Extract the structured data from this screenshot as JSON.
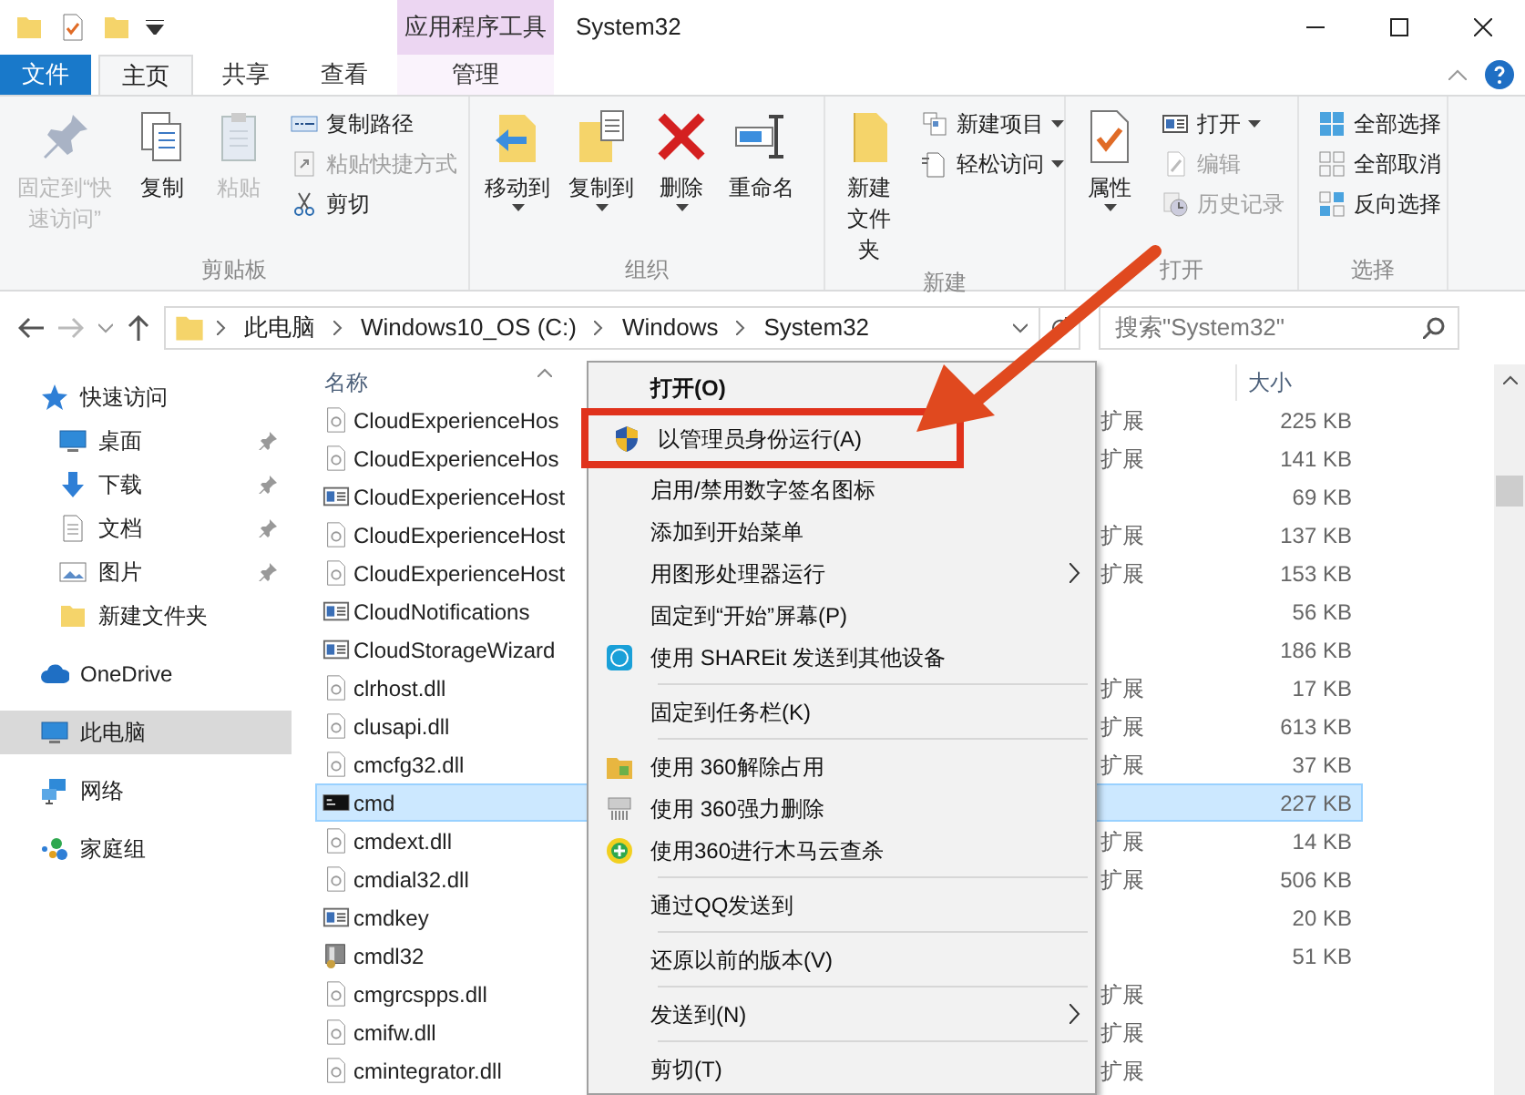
{
  "title_bar": {
    "context_tab_group": "应用程序工具",
    "title": "System32"
  },
  "tabs": [
    {
      "label": "文件",
      "kind": "file",
      "selected": false
    },
    {
      "label": "主页",
      "kind": "normal",
      "selected": true
    },
    {
      "label": "共享",
      "kind": "normal",
      "selected": false
    },
    {
      "label": "查看",
      "kind": "normal",
      "selected": false
    },
    {
      "label": "管理",
      "kind": "contextual",
      "selected": false
    }
  ],
  "ribbon_groups": [
    {
      "label": "剪贴板",
      "commands": [
        {
          "label": "固定到“快速访问”",
          "kind": "large",
          "disabled": true,
          "dropdown": false
        },
        {
          "label": "复制",
          "kind": "large",
          "disabled": false,
          "dropdown": false
        },
        {
          "label": "粘贴",
          "kind": "large",
          "disabled": true,
          "dropdown": false
        },
        {
          "label": "复制路径",
          "kind": "small",
          "disabled": false,
          "dropdown": false
        },
        {
          "label": "粘贴快捷方式",
          "kind": "small",
          "disabled": true,
          "dropdown": false
        },
        {
          "label": "剪切",
          "kind": "small",
          "disabled": false,
          "dropdown": false
        }
      ]
    },
    {
      "label": "组织",
      "commands": [
        {
          "label": "移动到",
          "kind": "large",
          "disabled": false,
          "dropdown": true
        },
        {
          "label": "复制到",
          "kind": "large",
          "disabled": false,
          "dropdown": true
        },
        {
          "label": "删除",
          "kind": "large",
          "disabled": false,
          "dropdown": true
        },
        {
          "label": "重命名",
          "kind": "large",
          "disabled": false,
          "dropdown": false
        }
      ]
    },
    {
      "label": "新建",
      "commands": [
        {
          "label": "新建文件夹",
          "kind": "large",
          "disabled": false,
          "dropdown": false
        },
        {
          "label": "新建项目",
          "kind": "small",
          "disabled": false,
          "dropdown": true
        },
        {
          "label": "轻松访问",
          "kind": "small",
          "disabled": false,
          "dropdown": true
        }
      ]
    },
    {
      "label": "打开",
      "commands": [
        {
          "label": "属性",
          "kind": "large",
          "disabled": false,
          "dropdown": true
        },
        {
          "label": "打开",
          "kind": "small",
          "disabled": false,
          "dropdown": true
        },
        {
          "label": "编辑",
          "kind": "small",
          "disabled": true,
          "dropdown": false
        },
        {
          "label": "历史记录",
          "kind": "small",
          "disabled": true,
          "dropdown": false
        }
      ]
    },
    {
      "label": "选择",
      "commands": [
        {
          "label": "全部选择",
          "kind": "small",
          "disabled": false,
          "dropdown": false
        },
        {
          "label": "全部取消",
          "kind": "small",
          "disabled": false,
          "dropdown": false
        },
        {
          "label": "反向选择",
          "kind": "small",
          "disabled": false,
          "dropdown": false
        }
      ]
    }
  ],
  "address_bar": {
    "path": [
      "此电脑",
      "Windows10_OS (C:)",
      "Windows",
      "System32"
    ]
  },
  "search": {
    "placeholder": "搜索\"System32\""
  },
  "navigation": [
    {
      "label": "快速访问",
      "pinned": false,
      "selected": false,
      "children": [
        {
          "label": "桌面",
          "pinned": true,
          "selected": false
        },
        {
          "label": "下载",
          "pinned": true,
          "selected": false
        },
        {
          "label": "文档",
          "pinned": true,
          "selected": false
        },
        {
          "label": "图片",
          "pinned": true,
          "selected": false
        },
        {
          "label": "新建文件夹",
          "pinned": false,
          "selected": false
        }
      ]
    },
    {
      "label": "OneDrive",
      "pinned": false,
      "selected": false
    },
    {
      "label": "此电脑",
      "pinned": false,
      "selected": true
    },
    {
      "label": "网络",
      "pinned": false,
      "selected": false
    },
    {
      "label": "家庭组",
      "pinned": false,
      "selected": false
    }
  ],
  "file_list": {
    "columns": {
      "name": "名称",
      "size": "大小"
    },
    "rows": [
      {
        "name": "CloudExperienceHos",
        "kind": "dll",
        "type": "扩展",
        "size": "225 KB",
        "selected": false
      },
      {
        "name": "CloudExperienceHos",
        "kind": "dll",
        "type": "扩展",
        "size": "141 KB",
        "selected": false
      },
      {
        "name": "CloudExperienceHost",
        "kind": "app",
        "size": "69 KB",
        "selected": false
      },
      {
        "name": "CloudExperienceHost",
        "kind": "dll",
        "type": "扩展",
        "size": "137 KB",
        "selected": false
      },
      {
        "name": "CloudExperienceHost",
        "kind": "dll",
        "type": "扩展",
        "size": "153 KB",
        "selected": false
      },
      {
        "name": "CloudNotifications",
        "kind": "app",
        "size": "56 KB",
        "selected": false
      },
      {
        "name": "CloudStorageWizard",
        "kind": "app",
        "size": "186 KB",
        "selected": false
      },
      {
        "name": "clrhost.dll",
        "kind": "dll",
        "type": "扩展",
        "size": "17 KB",
        "selected": false
      },
      {
        "name": "clusapi.dll",
        "kind": "dll",
        "type": "扩展",
        "size": "613 KB",
        "selected": false
      },
      {
        "name": "cmcfg32.dll",
        "kind": "dll",
        "type": "扩展",
        "size": "37 KB",
        "selected": false
      },
      {
        "name": "cmd",
        "kind": "console",
        "size": "227 KB",
        "selected": true
      },
      {
        "name": "cmdext.dll",
        "kind": "dll",
        "type": "扩展",
        "size": "14 KB",
        "selected": false
      },
      {
        "name": "cmdial32.dll",
        "kind": "dll",
        "type": "扩展",
        "size": "506 KB",
        "selected": false
      },
      {
        "name": "cmdkey",
        "kind": "app",
        "size": "20 KB",
        "selected": false
      },
      {
        "name": "cmdl32",
        "kind": "installer",
        "size": "51 KB",
        "selected": false
      },
      {
        "name": "cmgrcspps.dll",
        "kind": "dll",
        "type": "扩展",
        "selected": false
      },
      {
        "name": "cmifw.dll",
        "kind": "dll",
        "type": "扩展",
        "selected": false
      },
      {
        "name": "cmintegrator.dll",
        "kind": "dll",
        "type": "扩展",
        "selected": false
      }
    ]
  },
  "context_menu": {
    "items": [
      {
        "kind": "item",
        "label": "打开(O)",
        "bold": true,
        "highlighted": false,
        "submenu": false
      },
      {
        "kind": "item",
        "label": "以管理员身份运行(A)",
        "bold": false,
        "highlighted": true,
        "submenu": false
      },
      {
        "kind": "item",
        "label": "启用/禁用数字签名图标",
        "bold": false,
        "highlighted": false,
        "submenu": false
      },
      {
        "kind": "item",
        "label": "添加到开始菜单",
        "bold": false,
        "highlighted": false,
        "submenu": false
      },
      {
        "kind": "item",
        "label": "用图形处理器运行",
        "bold": false,
        "highlighted": false,
        "submenu": true
      },
      {
        "kind": "item",
        "label": "固定到“开始”屏幕(P)",
        "bold": false,
        "highlighted": false,
        "submenu": false
      },
      {
        "kind": "item",
        "label": "使用 SHAREit 发送到其他设备",
        "bold": false,
        "highlighted": false,
        "submenu": false
      },
      {
        "kind": "separator"
      },
      {
        "kind": "item",
        "label": "固定到任务栏(K)",
        "bold": false,
        "highlighted": false,
        "submenu": false
      },
      {
        "kind": "separator"
      },
      {
        "kind": "item",
        "label": "使用 360解除占用",
        "bold": false,
        "highlighted": false,
        "submenu": false
      },
      {
        "kind": "item",
        "label": "使用 360强力删除",
        "bold": false,
        "highlighted": false,
        "submenu": false
      },
      {
        "kind": "item",
        "label": "使用360进行木马云查杀",
        "bold": false,
        "highlighted": false,
        "submenu": false
      },
      {
        "kind": "separator"
      },
      {
        "kind": "item",
        "label": "通过QQ发送到",
        "bold": false,
        "highlighted": false,
        "submenu": false
      },
      {
        "kind": "separator"
      },
      {
        "kind": "item",
        "label": "还原以前的版本(V)",
        "bold": false,
        "highlighted": false,
        "submenu": false
      },
      {
        "kind": "separator"
      },
      {
        "kind": "item",
        "label": "发送到(N)",
        "bold": false,
        "highlighted": false,
        "submenu": true
      },
      {
        "kind": "separator"
      },
      {
        "kind": "item",
        "label": "剪切(T)",
        "bold": false,
        "highlighted": false,
        "submenu": false
      }
    ]
  }
}
